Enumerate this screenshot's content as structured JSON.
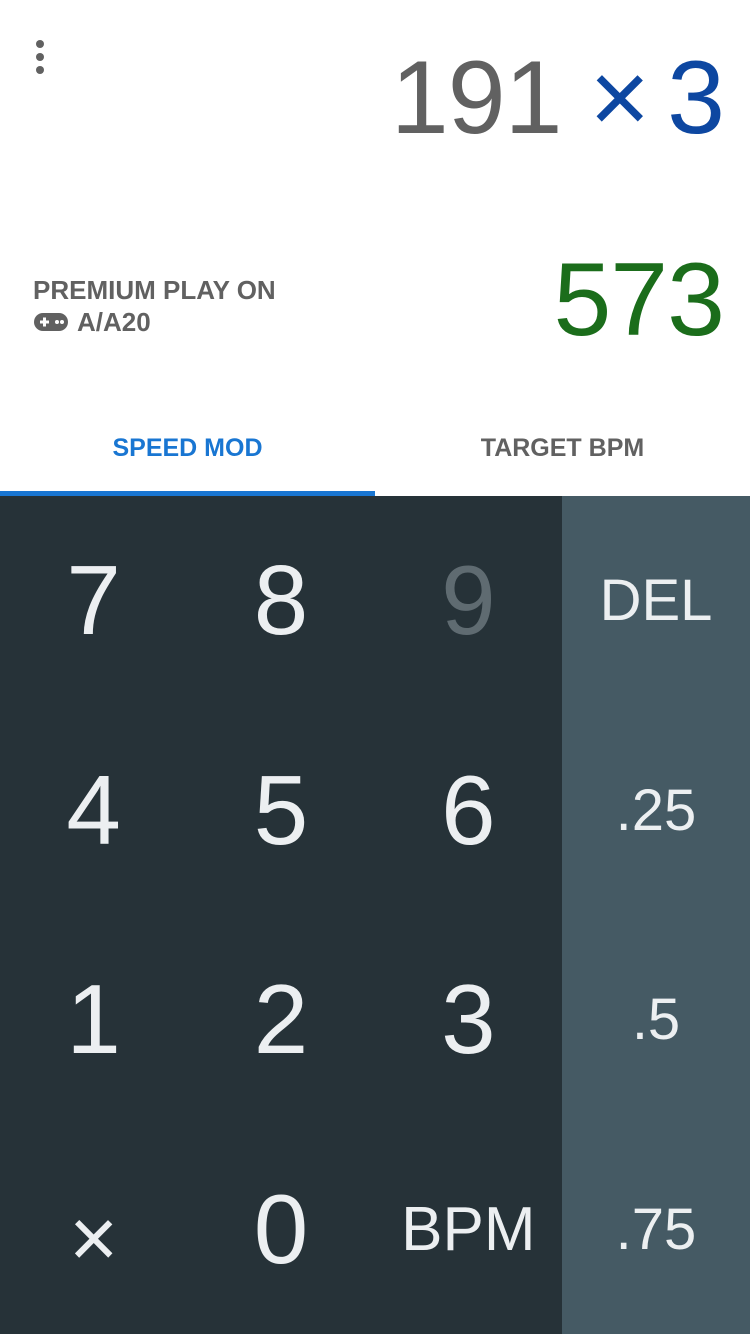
{
  "header": {
    "bpm": "191",
    "operator": "×",
    "speed_mod": "3",
    "result": "573",
    "game_line1": "PREMIUM PLAY ON",
    "game_line2": "A/A20",
    "game_icon": "gamepad-icon",
    "menu_icon": "more-vert-icon"
  },
  "tabs": [
    {
      "label": "SPEED MOD",
      "active": true
    },
    {
      "label": "TARGET BPM",
      "active": false
    }
  ],
  "keypad": {
    "digits": [
      "7",
      "8",
      "9",
      "4",
      "5",
      "6",
      "1",
      "2",
      "3",
      "×",
      "0",
      "BPM"
    ],
    "side": [
      "DEL",
      ".25",
      ".5",
      ".75"
    ]
  },
  "colors": {
    "accent": "#1976d2",
    "operator": "#0d47a1",
    "result": "#1b6d1b",
    "numpad_bg": "#263238",
    "sidepad_bg": "#455a64"
  }
}
